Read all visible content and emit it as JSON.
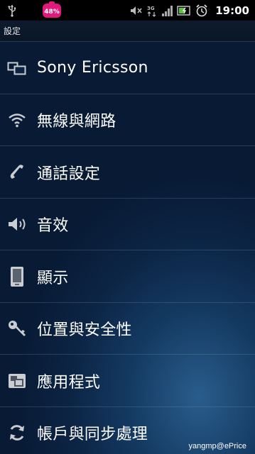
{
  "status_bar": {
    "battery_notification": "48%",
    "network_type": "3G",
    "time": "19:00"
  },
  "title_bar": {
    "title": "設定"
  },
  "settings": [
    {
      "label": "Sony Ericsson",
      "icon": "sony-ericsson-icon"
    },
    {
      "label": "無線與網路",
      "icon": "wifi-icon"
    },
    {
      "label": "通話設定",
      "icon": "phone-icon"
    },
    {
      "label": "音效",
      "icon": "speaker-icon"
    },
    {
      "label": "顯示",
      "icon": "display-icon"
    },
    {
      "label": "位置與安全性",
      "icon": "key-icon"
    },
    {
      "label": "應用程式",
      "icon": "applications-icon"
    },
    {
      "label": "帳戶與同步處理",
      "icon": "sync-icon"
    }
  ],
  "watermark": "yangmp@ePrice",
  "colors": {
    "background": "#0c2444",
    "accent": "#e0197a"
  }
}
